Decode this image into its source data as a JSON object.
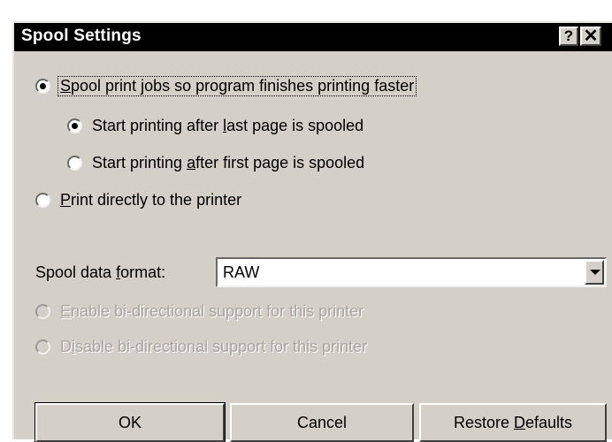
{
  "title": "Spool Settings",
  "titlebar": {
    "help_glyph": "?",
    "close_glyph": "✕"
  },
  "options": {
    "spool": {
      "pre": "",
      "ul": "S",
      "post": "pool print jobs so program finishes printing faster",
      "checked": true
    },
    "after_last": {
      "pre": "Start printing after ",
      "ul": "l",
      "post": "ast page is spooled",
      "checked": true
    },
    "after_first": {
      "pre": "Start printing ",
      "ul": "a",
      "post": "fter first page is spooled",
      "checked": false
    },
    "direct": {
      "pre": "",
      "ul": "P",
      "post": "rint directly to the printer",
      "checked": false
    }
  },
  "format": {
    "label_pre": "Spool data ",
    "label_ul": "f",
    "label_post": "ormat:",
    "value": "RAW"
  },
  "bidi": {
    "enable": {
      "pre": "",
      "ul": "E",
      "post": "nable bi-directional support for this printer",
      "disabled": true
    },
    "disable": {
      "pre": "D",
      "ul": "i",
      "post": "sable bi-directional support for this printer",
      "disabled": true
    }
  },
  "buttons": {
    "ok": "OK",
    "cancel": "Cancel",
    "restore_pre": "Restore ",
    "restore_ul": "D",
    "restore_post": "efaults"
  },
  "colors": {
    "face": "#d4d0c8",
    "titlebar": "#000000",
    "disabled_text": "#a9a6a0"
  }
}
